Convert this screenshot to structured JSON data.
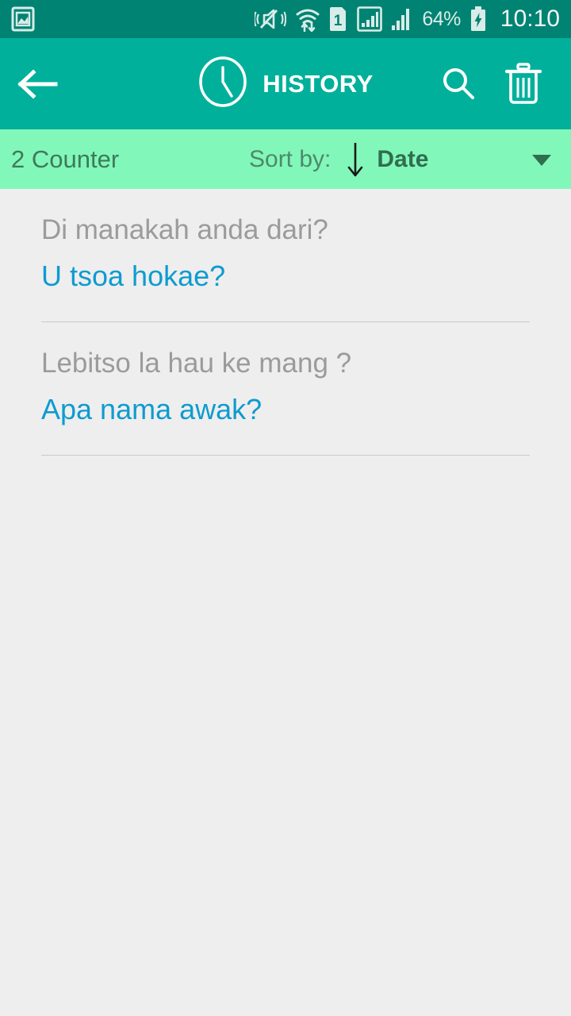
{
  "status_bar": {
    "icons": [
      "gallery-image-icon",
      "vibrate-mute-icon",
      "wifi-transfer-icon",
      "sim-1-icon",
      "signal-sim1-icon",
      "signal-sim2-icon"
    ],
    "sim_label": "1",
    "battery_percent": "64%",
    "battery_state": "charging",
    "clock": "10:10",
    "background": "#008373",
    "foreground": "#d9ece8"
  },
  "toolbar": {
    "back_label": "back-arrow",
    "title": "HISTORY",
    "title_icon": "clock-icon",
    "search_label": "search",
    "delete_label": "delete-all",
    "background": "#00b09b",
    "foreground": "#ffffff"
  },
  "sort_bar": {
    "counter": "2 Counter",
    "sort_by_label": "Sort by:",
    "sort_direction": "descending",
    "sort_value": "Date",
    "dropdown_icon": "chevron-down-icon",
    "background": "#82f7ba",
    "text_color": "#3d7a5a",
    "value_color": "#2f6e4e"
  },
  "history": {
    "source_color": "#9b9b9b",
    "target_color": "#0e9bd0",
    "items": [
      {
        "source": "Di manakah anda dari?",
        "target": "U tsoa hokae?"
      },
      {
        "source": "Lebitso la hau ke mang ?",
        "target": "Apa nama awak?"
      }
    ]
  }
}
